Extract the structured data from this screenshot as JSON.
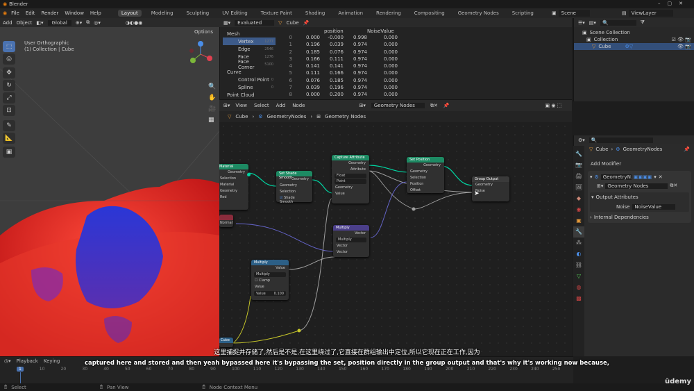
{
  "window": {
    "title": "Blender"
  },
  "menu": [
    "File",
    "Edit",
    "Render",
    "Window",
    "Help"
  ],
  "workspaces": [
    "Layout",
    "Modeling",
    "Sculpting",
    "UV Editing",
    "Texture Paint",
    "Shading",
    "Animation",
    "Rendering",
    "Compositing",
    "Geometry Nodes",
    "Scripting"
  ],
  "active_workspace": "Layout",
  "scene": "Scene",
  "view_layer": "ViewLayer",
  "viewport": {
    "mode_add": "Add",
    "mode_obj": "Object",
    "transform": "Global",
    "overlay1": "User Orthographic",
    "overlay2": "(1) Collection | Cube",
    "options": "Options"
  },
  "spreadsheet": {
    "evaluated": "Evaluated",
    "object": "Cube",
    "tree": [
      {
        "label": "Mesh"
      },
      {
        "label": "Vertex",
        "count": "1277"
      },
      {
        "label": "Edge",
        "count": "2546"
      },
      {
        "label": "Face",
        "count": "1276"
      },
      {
        "label": "Face Corner",
        "count": "5100"
      },
      {
        "label": "Curve"
      },
      {
        "label": "Control Point",
        "count": "0"
      },
      {
        "label": "Spline",
        "count": "0"
      },
      {
        "label": "Point Cloud"
      }
    ],
    "headers": [
      "position",
      "NoiseValue"
    ],
    "rows": [
      [
        "0",
        "0.000",
        "-0.000",
        "0.998",
        "0.000"
      ],
      [
        "1",
        "0.196",
        "0.039",
        "0.974",
        "0.000"
      ],
      [
        "2",
        "0.185",
        "0.076",
        "0.974",
        "0.000"
      ],
      [
        "3",
        "0.166",
        "0.111",
        "0.974",
        "0.000"
      ],
      [
        "4",
        "0.141",
        "0.141",
        "0.974",
        "0.000"
      ],
      [
        "5",
        "0.111",
        "0.166",
        "0.974",
        "0.000"
      ],
      [
        "6",
        "0.076",
        "0.185",
        "0.974",
        "0.000"
      ],
      [
        "7",
        "0.039",
        "0.196",
        "0.974",
        "0.000"
      ],
      [
        "8",
        "0.000",
        "0.200",
        "0.974",
        "0.000"
      ]
    ]
  },
  "node_editor": {
    "menus": [
      "View",
      "Select",
      "Add",
      "Node"
    ],
    "tree_name": "Geometry Nodes",
    "breadcrumb": [
      "Cube",
      "GeometryNodes",
      "Geometry Nodes"
    ]
  },
  "nodes": {
    "material": {
      "title": "Material",
      "rows": [
        "Geometry",
        "Selection",
        "Material",
        "Geometry",
        "Red"
      ]
    },
    "shade": {
      "title": "Set Shade Smooth",
      "out": "Geometry",
      "rows": [
        "Geometry",
        "Selection",
        "Shade Smooth"
      ]
    },
    "capture": {
      "title": "Capture Attribute",
      "outs": [
        "Geometry",
        "Attribute"
      ],
      "dd1": "Float",
      "dd2": "Point",
      "ins": [
        "Geometry",
        "Value"
      ]
    },
    "setpos": {
      "title": "Set Position",
      "out": "Geometry",
      "ins": [
        "Geometry",
        "Selection",
        "Position",
        "Offset"
      ]
    },
    "output": {
      "title": "Group Output",
      "ins": [
        "Geometry",
        "Noise"
      ]
    },
    "multiply_v": {
      "title": "Multiply",
      "out": "Vector",
      "dd": "Multiply",
      "ins": [
        "Vector",
        "Vector"
      ]
    },
    "multiply_f": {
      "title": "Multiply",
      "out": "Value",
      "dd": "Multiply",
      "clamp": "Clamp",
      "in": "Value",
      "value_label": "Value",
      "value": "0.100"
    },
    "normal": {
      "title": "Normal"
    },
    "cube": {
      "title": "Cube"
    }
  },
  "outliner": {
    "root": "Scene Collection",
    "collection": "Collection",
    "object": "Cube"
  },
  "properties": {
    "object": "Cube",
    "modifier": "GeometryNodes",
    "add_modifier": "Add Modifier",
    "mod_name": "GeometryN...",
    "tree": "Geometry Nodes",
    "output_attrs": "Output Attributes",
    "noise_label": "Noise",
    "noise_value": "NoiseValue",
    "internal": "Internal Dependencies"
  },
  "timeline": {
    "playback": "Playback",
    "keying": "Keying",
    "ticks": [
      "0",
      "10",
      "20",
      "30",
      "40",
      "50",
      "60",
      "70",
      "80",
      "90",
      "100",
      "110",
      "120",
      "130",
      "140",
      "150",
      "160",
      "170",
      "180",
      "190",
      "200",
      "210",
      "220",
      "230",
      "240",
      "250"
    ],
    "current": "1"
  },
  "status": {
    "select": "Select",
    "pan": "Pan View",
    "context": "Node Context Menu"
  },
  "subtitles": {
    "zh": "这里捕捉并存储了,然后是不是,在这里绕过了,它直接在群组输出中定位,所以它现在正在工作,因为",
    "en": "captured here and stored and then yeah bypassed here it's bypassing the set, position directly in the group output and that's why it's working now because,"
  },
  "watermark": "ūdemy"
}
